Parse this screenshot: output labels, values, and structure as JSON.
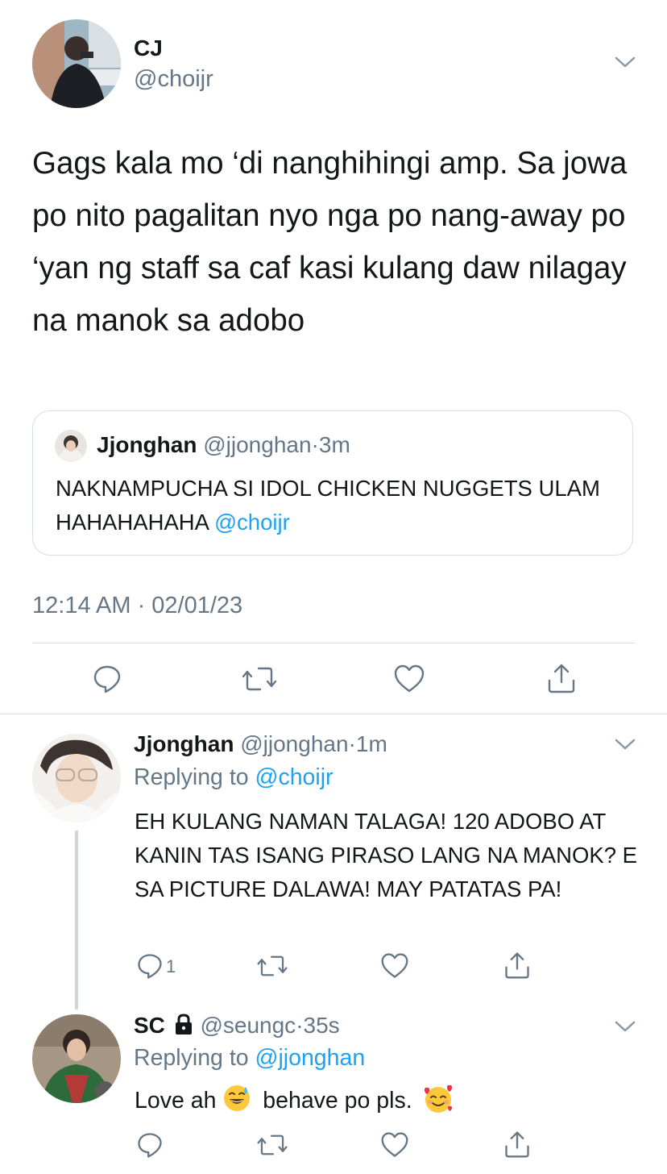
{
  "main_tweet": {
    "author_name": "CJ",
    "author_handle": "@choijr",
    "text": "Gags kala mo ‘di nanghihingi amp. Sa jowa po nito pagalitan nyo nga po nang-away po ‘yan ng staff sa caf kasi kulang daw nilagay na manok sa adobo",
    "quoted": {
      "author_name": "Jjonghan",
      "author_handle": "@jjonghan",
      "separator": "·",
      "age": "3m",
      "text": "NAKNAMPUCHA SI IDOL CHICKEN NUGGETS ULAM HAHAHAHAHA",
      "mention": "@choijr"
    },
    "timestamp": "12:14 AM · 02/01/23"
  },
  "replies": [
    {
      "author_name": "Jjonghan",
      "author_handle": "@jjonghan",
      "separator": "·",
      "age": "1m",
      "replying_label": "Replying to",
      "replying_to": "@choijr",
      "text": "EH KULANG NAMAN TALAGA! 120 ADOBO AT KANIN TAS ISANG PIRASO LANG NA MANOK? E SA PICTURE DALAWA! MAY PATATAS PA!",
      "reply_count": "1"
    },
    {
      "author_name": "SC",
      "author_handle": "@seungc",
      "separator": "·",
      "age": "35s",
      "replying_label": "Replying to",
      "replying_to": "@jjonghan",
      "text_part1": "Love ah",
      "text_part2": "behave po pls.",
      "emoji_1": "sweat-smile-emoji",
      "emoji_2": "smiling-face-with-hearts-emoji"
    }
  ],
  "colors": {
    "accent": "#1da1f2",
    "muted": "#657786",
    "divider": "#d6dde3"
  }
}
